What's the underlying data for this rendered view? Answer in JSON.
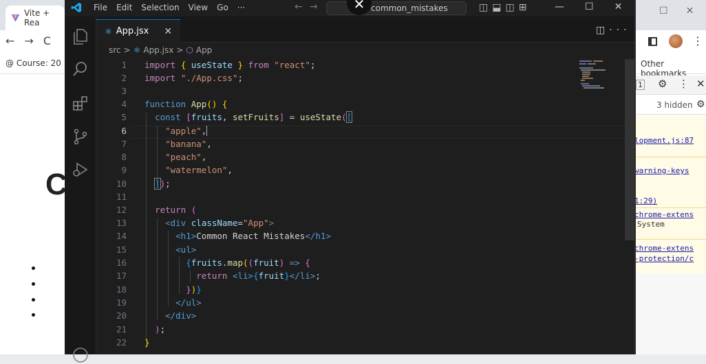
{
  "background_browser": {
    "tab_title": "Vite + Rea",
    "bookmark": "Course: 20",
    "page_heading": "C",
    "other_bookmarks": "Other bookmarks",
    "devtools": {
      "counter": "1",
      "hidden_label": "3 hidden",
      "console_lines": [
        "lopment.js:87",
        "warning-keys",
        "1:29)",
        "chrome-extens",
        "System",
        "chrome-extens",
        "-protection/c"
      ]
    }
  },
  "vscode": {
    "menu": [
      "File",
      "Edit",
      "Selection",
      "View",
      "Go",
      "···"
    ],
    "command_center": "common_mistakes",
    "tab": {
      "label": "App.jsx",
      "close": "✕"
    },
    "breadcrumb": {
      "folder": "src",
      "sep": ">",
      "file": "App.jsx",
      "symbol": "App"
    },
    "active_line": 6,
    "line_numbers": [
      "1",
      "2",
      "3",
      "4",
      "5",
      "6",
      "7",
      "8",
      "9",
      "10",
      "11",
      "12",
      "13",
      "14",
      "15",
      "16",
      "17",
      "18",
      "19",
      "20",
      "21",
      "22"
    ],
    "code": {
      "l1": {
        "kw1": "import",
        "open": "{",
        "id": "useState",
        "close": "}",
        "kw2": "from",
        "str": "\"react\"",
        "end": ";"
      },
      "l2": {
        "kw": "import",
        "str": "\"./App.css\"",
        "end": ";"
      },
      "l4": {
        "kw": "function",
        "name": "App",
        "parens": "()",
        "brace": "{"
      },
      "l5": {
        "kw": "const",
        "ob": "[",
        "a": "fruits",
        "comma": ",",
        "b": "setFruits",
        "cb": "]",
        "eq": "=",
        "fn": "useState",
        "op": "(",
        "arr": "["
      },
      "l6": {
        "str": "\"apple\"",
        "comma": ","
      },
      "l7": {
        "str": "\"banana\"",
        "comma": ","
      },
      "l8": {
        "str": "\"peach\"",
        "comma": ","
      },
      "l9": {
        "str": "\"watermelon\"",
        "comma": ","
      },
      "l10": {
        "arr": "]",
        "cp": ")",
        "end": ";"
      },
      "l12": {
        "kw": "return",
        "op": "("
      },
      "l13": {
        "lt": "<",
        "tag": "div",
        "attr": "className",
        "eq": "=",
        "val": "\"App\"",
        "gt": ">"
      },
      "l14": {
        "open": "<h1>",
        "text": "Common React Mistakes",
        "close": "</h1>"
      },
      "l15": {
        "open": "<ul>"
      },
      "l16": {
        "ob": "{",
        "a": "fruits",
        "dot": ".",
        "fn": "map",
        "op1": "(",
        "op2": "(",
        "param": "fruit",
        "cp": ")",
        "arrow": "=>",
        "brace": "{"
      },
      "l17": {
        "kw": "return",
        "open": "<li>",
        "ob": "{",
        "v": "fruit",
        "cb": "}",
        "close": "</li>",
        "end": ";"
      },
      "l18": {
        "cb": "}",
        "cp": ")",
        "cb2": "}"
      },
      "l19": {
        "close": "</ul>"
      },
      "l20": {
        "close": "</div>"
      },
      "l21": {
        "cp": ")",
        "end": ";"
      },
      "l22": {
        "cb": "}"
      }
    }
  }
}
